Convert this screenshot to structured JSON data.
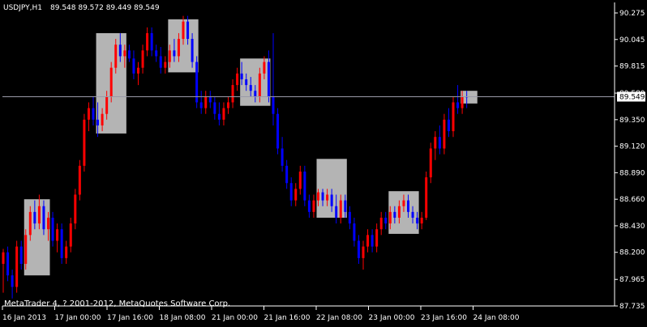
{
  "header": {
    "symbol_timeframe": "USDJPY,H1",
    "ohlc": "89.548 89.572 89.449 89.549"
  },
  "footer": {
    "copyright": "MetaTrader 4, ? 2001-2012, MetaQuotes Software Corp."
  },
  "colors": {
    "background": "#000000",
    "bull": "#ff0000",
    "bear": "#0000ff",
    "box": "#b4b4b4",
    "axis": "#ffffff",
    "price_line": "#9a9aa8"
  },
  "chart_data": {
    "type": "candlestick",
    "symbol": "USDJPY",
    "timeframe": "H1",
    "y_ticks": [
      "90.275",
      "90.045",
      "89.815",
      "89.580",
      "89.350",
      "89.120",
      "88.890",
      "88.660",
      "88.430",
      "88.200",
      "87.965",
      "87.735"
    ],
    "ylim": [
      87.735,
      90.275
    ],
    "x_ticks": [
      "16 Jan 2013",
      "17 Jan 00:00",
      "17 Jan 16:00",
      "18 Jan 08:00",
      "21 Jan 00:00",
      "21 Jan 16:00",
      "22 Jan 08:00",
      "23 Jan 00:00",
      "23 Jan 16:00",
      "24 Jan 08:00"
    ],
    "current_price": "89.549",
    "current_price_value": 89.549,
    "candles": [
      {
        "o": 88.1,
        "h": 88.23,
        "l": 87.85,
        "c": 88.2
      },
      {
        "o": 88.2,
        "h": 88.25,
        "l": 87.95,
        "c": 88.0
      },
      {
        "o": 88.0,
        "h": 88.05,
        "l": 87.8,
        "c": 87.9
      },
      {
        "o": 87.9,
        "h": 88.3,
        "l": 87.85,
        "c": 88.25
      },
      {
        "o": 88.25,
        "h": 88.3,
        "l": 88.05,
        "c": 88.1
      },
      {
        "o": 88.1,
        "h": 88.4,
        "l": 88.05,
        "c": 88.35
      },
      {
        "o": 88.35,
        "h": 88.6,
        "l": 88.3,
        "c": 88.55
      },
      {
        "o": 88.55,
        "h": 88.65,
        "l": 88.4,
        "c": 88.45
      },
      {
        "o": 88.45,
        "h": 88.7,
        "l": 88.4,
        "c": 88.6
      },
      {
        "o": 88.6,
        "h": 88.65,
        "l": 88.35,
        "c": 88.4
      },
      {
        "o": 88.4,
        "h": 88.55,
        "l": 88.3,
        "c": 88.5
      },
      {
        "o": 88.5,
        "h": 88.55,
        "l": 88.25,
        "c": 88.3
      },
      {
        "o": 88.3,
        "h": 88.45,
        "l": 88.2,
        "c": 88.4
      },
      {
        "o": 88.4,
        "h": 88.45,
        "l": 88.1,
        "c": 88.15
      },
      {
        "o": 88.15,
        "h": 88.3,
        "l": 88.1,
        "c": 88.25
      },
      {
        "o": 88.25,
        "h": 88.5,
        "l": 88.2,
        "c": 88.45
      },
      {
        "o": 88.45,
        "h": 88.75,
        "l": 88.4,
        "c": 88.7
      },
      {
        "o": 88.7,
        "h": 89.0,
        "l": 88.65,
        "c": 88.95
      },
      {
        "o": 88.95,
        "h": 89.4,
        "l": 88.9,
        "c": 89.35
      },
      {
        "o": 89.35,
        "h": 89.5,
        "l": 89.25,
        "c": 89.45
      },
      {
        "o": 89.45,
        "h": 89.55,
        "l": 89.3,
        "c": 89.35
      },
      {
        "o": 89.35,
        "h": 89.5,
        "l": 89.2,
        "c": 89.3
      },
      {
        "o": 89.3,
        "h": 89.45,
        "l": 89.25,
        "c": 89.4
      },
      {
        "o": 89.4,
        "h": 89.6,
        "l": 89.35,
        "c": 89.55
      },
      {
        "o": 89.55,
        "h": 89.85,
        "l": 89.5,
        "c": 89.8
      },
      {
        "o": 89.8,
        "h": 90.05,
        "l": 89.75,
        "c": 90.0
      },
      {
        "o": 90.0,
        "h": 90.1,
        "l": 89.85,
        "c": 89.9
      },
      {
        "o": 89.9,
        "h": 90.0,
        "l": 89.8,
        "c": 89.95
      },
      {
        "o": 89.95,
        "h": 90.0,
        "l": 89.85,
        "c": 89.88
      },
      {
        "o": 89.88,
        "h": 89.95,
        "l": 89.7,
        "c": 89.75
      },
      {
        "o": 89.75,
        "h": 89.85,
        "l": 89.65,
        "c": 89.8
      },
      {
        "o": 89.8,
        "h": 90.0,
        "l": 89.75,
        "c": 89.95
      },
      {
        "o": 89.95,
        "h": 90.15,
        "l": 89.9,
        "c": 90.1
      },
      {
        "o": 90.1,
        "h": 90.15,
        "l": 89.9,
        "c": 89.95
      },
      {
        "o": 89.95,
        "h": 90.0,
        "l": 89.85,
        "c": 89.9
      },
      {
        "o": 89.9,
        "h": 89.98,
        "l": 89.75,
        "c": 89.8
      },
      {
        "o": 89.8,
        "h": 89.9,
        "l": 89.75,
        "c": 89.85
      },
      {
        "o": 89.85,
        "h": 90.0,
        "l": 89.8,
        "c": 89.95
      },
      {
        "o": 89.95,
        "h": 90.05,
        "l": 89.85,
        "c": 89.9
      },
      {
        "o": 89.9,
        "h": 90.1,
        "l": 89.85,
        "c": 90.05
      },
      {
        "o": 90.05,
        "h": 90.25,
        "l": 90.0,
        "c": 90.2
      },
      {
        "o": 90.2,
        "h": 90.25,
        "l": 90.0,
        "c": 90.05
      },
      {
        "o": 90.05,
        "h": 90.1,
        "l": 89.8,
        "c": 89.85
      },
      {
        "o": 89.85,
        "h": 89.9,
        "l": 89.45,
        "c": 89.5
      },
      {
        "o": 89.5,
        "h": 89.6,
        "l": 89.4,
        "c": 89.45
      },
      {
        "o": 89.45,
        "h": 89.6,
        "l": 89.4,
        "c": 89.55
      },
      {
        "o": 89.55,
        "h": 89.6,
        "l": 89.45,
        "c": 89.5
      },
      {
        "o": 89.5,
        "h": 89.55,
        "l": 89.35,
        "c": 89.4
      },
      {
        "o": 89.4,
        "h": 89.5,
        "l": 89.3,
        "c": 89.35
      },
      {
        "o": 89.35,
        "h": 89.5,
        "l": 89.3,
        "c": 89.45
      },
      {
        "o": 89.45,
        "h": 89.55,
        "l": 89.4,
        "c": 89.5
      },
      {
        "o": 89.5,
        "h": 89.7,
        "l": 89.45,
        "c": 89.65
      },
      {
        "o": 89.65,
        "h": 89.8,
        "l": 89.6,
        "c": 89.75
      },
      {
        "o": 89.75,
        "h": 89.85,
        "l": 89.65,
        "c": 89.7
      },
      {
        "o": 89.7,
        "h": 89.75,
        "l": 89.6,
        "c": 89.65
      },
      {
        "o": 89.65,
        "h": 89.72,
        "l": 89.55,
        "c": 89.6
      },
      {
        "o": 89.6,
        "h": 89.65,
        "l": 89.5,
        "c": 89.55
      },
      {
        "o": 89.55,
        "h": 89.8,
        "l": 89.5,
        "c": 89.75
      },
      {
        "o": 89.75,
        "h": 89.9,
        "l": 89.7,
        "c": 89.85
      },
      {
        "o": 89.85,
        "h": 89.95,
        "l": 89.5,
        "c": 89.55
      },
      {
        "o": 89.55,
        "h": 90.1,
        "l": 89.3,
        "c": 89.4
      },
      {
        "o": 89.4,
        "h": 89.45,
        "l": 89.05,
        "c": 89.1
      },
      {
        "o": 89.1,
        "h": 89.2,
        "l": 88.9,
        "c": 88.95
      },
      {
        "o": 88.95,
        "h": 89.0,
        "l": 88.75,
        "c": 88.8
      },
      {
        "o": 88.8,
        "h": 88.85,
        "l": 88.6,
        "c": 88.65
      },
      {
        "o": 88.65,
        "h": 88.8,
        "l": 88.6,
        "c": 88.75
      },
      {
        "o": 88.75,
        "h": 88.95,
        "l": 88.7,
        "c": 88.9
      },
      {
        "o": 88.9,
        "h": 88.95,
        "l": 88.6,
        "c": 88.65
      },
      {
        "o": 88.65,
        "h": 88.7,
        "l": 88.5,
        "c": 88.55
      },
      {
        "o": 88.55,
        "h": 88.7,
        "l": 88.5,
        "c": 88.65
      },
      {
        "o": 88.65,
        "h": 88.75,
        "l": 88.6,
        "c": 88.72
      },
      {
        "o": 88.72,
        "h": 88.75,
        "l": 88.6,
        "c": 88.65
      },
      {
        "o": 88.65,
        "h": 88.75,
        "l": 88.6,
        "c": 88.7
      },
      {
        "o": 88.7,
        "h": 88.75,
        "l": 88.55,
        "c": 88.6
      },
      {
        "o": 88.6,
        "h": 88.7,
        "l": 88.45,
        "c": 88.5
      },
      {
        "o": 88.5,
        "h": 88.7,
        "l": 88.45,
        "c": 88.65
      },
      {
        "o": 88.65,
        "h": 88.7,
        "l": 88.5,
        "c": 88.55
      },
      {
        "o": 88.55,
        "h": 88.6,
        "l": 88.4,
        "c": 88.45
      },
      {
        "o": 88.45,
        "h": 88.5,
        "l": 88.25,
        "c": 88.3
      },
      {
        "o": 88.3,
        "h": 88.35,
        "l": 88.1,
        "c": 88.15
      },
      {
        "o": 88.15,
        "h": 88.3,
        "l": 88.05,
        "c": 88.25
      },
      {
        "o": 88.25,
        "h": 88.4,
        "l": 88.2,
        "c": 88.35
      },
      {
        "o": 88.35,
        "h": 88.4,
        "l": 88.2,
        "c": 88.25
      },
      {
        "o": 88.25,
        "h": 88.45,
        "l": 88.2,
        "c": 88.4
      },
      {
        "o": 88.4,
        "h": 88.55,
        "l": 88.35,
        "c": 88.5
      },
      {
        "o": 88.5,
        "h": 88.55,
        "l": 88.4,
        "c": 88.45
      },
      {
        "o": 88.45,
        "h": 88.6,
        "l": 88.4,
        "c": 88.55
      },
      {
        "o": 88.55,
        "h": 88.6,
        "l": 88.45,
        "c": 88.5
      },
      {
        "o": 88.5,
        "h": 88.65,
        "l": 88.45,
        "c": 88.6
      },
      {
        "o": 88.6,
        "h": 88.7,
        "l": 88.55,
        "c": 88.65
      },
      {
        "o": 88.65,
        "h": 88.7,
        "l": 88.5,
        "c": 88.55
      },
      {
        "o": 88.55,
        "h": 88.6,
        "l": 88.45,
        "c": 88.5
      },
      {
        "o": 88.5,
        "h": 88.55,
        "l": 88.4,
        "c": 88.45
      },
      {
        "o": 88.45,
        "h": 88.55,
        "l": 88.4,
        "c": 88.5
      },
      {
        "o": 88.5,
        "h": 88.9,
        "l": 88.48,
        "c": 88.85
      },
      {
        "o": 88.85,
        "h": 89.15,
        "l": 88.8,
        "c": 89.1
      },
      {
        "o": 89.1,
        "h": 89.25,
        "l": 89.0,
        "c": 89.2
      },
      {
        "o": 89.2,
        "h": 89.3,
        "l": 89.05,
        "c": 89.1
      },
      {
        "o": 89.1,
        "h": 89.4,
        "l": 89.05,
        "c": 89.35
      },
      {
        "o": 89.35,
        "h": 89.45,
        "l": 89.2,
        "c": 89.25
      },
      {
        "o": 89.25,
        "h": 89.55,
        "l": 89.2,
        "c": 89.5
      },
      {
        "o": 89.5,
        "h": 89.65,
        "l": 89.4,
        "c": 89.45
      },
      {
        "o": 89.45,
        "h": 89.6,
        "l": 89.4,
        "c": 89.55
      },
      {
        "o": 89.55,
        "h": 89.6,
        "l": 89.45,
        "c": 89.549
      }
    ],
    "boxes": [
      {
        "from": 5,
        "to": 10,
        "top": 88.66,
        "bottom": 88.0
      },
      {
        "from": 21,
        "to": 27,
        "top": 90.1,
        "bottom": 89.23
      },
      {
        "from": 37,
        "to": 43,
        "top": 90.22,
        "bottom": 89.76
      },
      {
        "from": 53,
        "to": 59,
        "top": 89.88,
        "bottom": 89.47
      },
      {
        "from": 70,
        "to": 76,
        "top": 89.01,
        "bottom": 88.5
      },
      {
        "from": 86,
        "to": 92,
        "top": 88.73,
        "bottom": 88.36
      },
      {
        "from": 102,
        "to": 105,
        "top": 89.6,
        "bottom": 89.49
      }
    ]
  }
}
